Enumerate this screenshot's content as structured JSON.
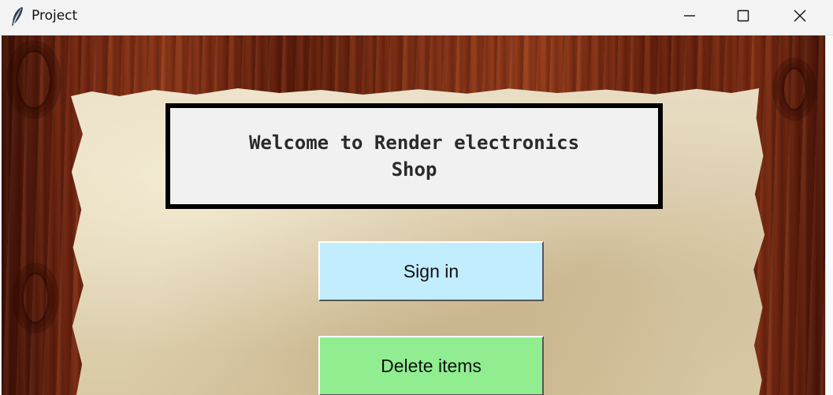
{
  "window": {
    "title": "Project",
    "app_icon": "feather-icon",
    "controls": {
      "minimize": "minimize-icon",
      "maximize": "maximize-icon",
      "close": "close-icon"
    }
  },
  "main": {
    "welcome_line1": "Welcome to Render electronics",
    "welcome_line2": "Shop",
    "sign_in_label": "Sign in",
    "delete_items_label": "Delete items"
  },
  "colors": {
    "sign_in_button": "#c2edff",
    "delete_items_button": "#90ee90",
    "welcome_box_border": "#000000",
    "welcome_box_bg": "#f1f1f1"
  }
}
